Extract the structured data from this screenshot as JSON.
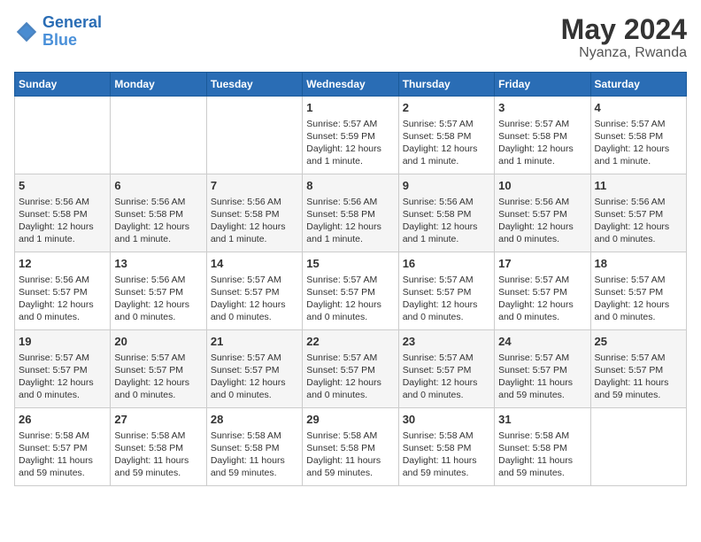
{
  "logo": {
    "line1": "General",
    "line2": "Blue"
  },
  "title": {
    "month_year": "May 2024",
    "location": "Nyanza, Rwanda"
  },
  "header_days": [
    "Sunday",
    "Monday",
    "Tuesday",
    "Wednesday",
    "Thursday",
    "Friday",
    "Saturday"
  ],
  "weeks": [
    {
      "days": [
        {
          "num": "",
          "info": ""
        },
        {
          "num": "",
          "info": ""
        },
        {
          "num": "",
          "info": ""
        },
        {
          "num": "1",
          "info": "Sunrise: 5:57 AM\nSunset: 5:59 PM\nDaylight: 12 hours\nand 1 minute."
        },
        {
          "num": "2",
          "info": "Sunrise: 5:57 AM\nSunset: 5:58 PM\nDaylight: 12 hours\nand 1 minute."
        },
        {
          "num": "3",
          "info": "Sunrise: 5:57 AM\nSunset: 5:58 PM\nDaylight: 12 hours\nand 1 minute."
        },
        {
          "num": "4",
          "info": "Sunrise: 5:57 AM\nSunset: 5:58 PM\nDaylight: 12 hours\nand 1 minute."
        }
      ]
    },
    {
      "days": [
        {
          "num": "5",
          "info": "Sunrise: 5:56 AM\nSunset: 5:58 PM\nDaylight: 12 hours\nand 1 minute."
        },
        {
          "num": "6",
          "info": "Sunrise: 5:56 AM\nSunset: 5:58 PM\nDaylight: 12 hours\nand 1 minute."
        },
        {
          "num": "7",
          "info": "Sunrise: 5:56 AM\nSunset: 5:58 PM\nDaylight: 12 hours\nand 1 minute."
        },
        {
          "num": "8",
          "info": "Sunrise: 5:56 AM\nSunset: 5:58 PM\nDaylight: 12 hours\nand 1 minute."
        },
        {
          "num": "9",
          "info": "Sunrise: 5:56 AM\nSunset: 5:58 PM\nDaylight: 12 hours\nand 1 minute."
        },
        {
          "num": "10",
          "info": "Sunrise: 5:56 AM\nSunset: 5:57 PM\nDaylight: 12 hours\nand 0 minutes."
        },
        {
          "num": "11",
          "info": "Sunrise: 5:56 AM\nSunset: 5:57 PM\nDaylight: 12 hours\nand 0 minutes."
        }
      ]
    },
    {
      "days": [
        {
          "num": "12",
          "info": "Sunrise: 5:56 AM\nSunset: 5:57 PM\nDaylight: 12 hours\nand 0 minutes."
        },
        {
          "num": "13",
          "info": "Sunrise: 5:56 AM\nSunset: 5:57 PM\nDaylight: 12 hours\nand 0 minutes."
        },
        {
          "num": "14",
          "info": "Sunrise: 5:57 AM\nSunset: 5:57 PM\nDaylight: 12 hours\nand 0 minutes."
        },
        {
          "num": "15",
          "info": "Sunrise: 5:57 AM\nSunset: 5:57 PM\nDaylight: 12 hours\nand 0 minutes."
        },
        {
          "num": "16",
          "info": "Sunrise: 5:57 AM\nSunset: 5:57 PM\nDaylight: 12 hours\nand 0 minutes."
        },
        {
          "num": "17",
          "info": "Sunrise: 5:57 AM\nSunset: 5:57 PM\nDaylight: 12 hours\nand 0 minutes."
        },
        {
          "num": "18",
          "info": "Sunrise: 5:57 AM\nSunset: 5:57 PM\nDaylight: 12 hours\nand 0 minutes."
        }
      ]
    },
    {
      "days": [
        {
          "num": "19",
          "info": "Sunrise: 5:57 AM\nSunset: 5:57 PM\nDaylight: 12 hours\nand 0 minutes."
        },
        {
          "num": "20",
          "info": "Sunrise: 5:57 AM\nSunset: 5:57 PM\nDaylight: 12 hours\nand 0 minutes."
        },
        {
          "num": "21",
          "info": "Sunrise: 5:57 AM\nSunset: 5:57 PM\nDaylight: 12 hours\nand 0 minutes."
        },
        {
          "num": "22",
          "info": "Sunrise: 5:57 AM\nSunset: 5:57 PM\nDaylight: 12 hours\nand 0 minutes."
        },
        {
          "num": "23",
          "info": "Sunrise: 5:57 AM\nSunset: 5:57 PM\nDaylight: 12 hours\nand 0 minutes."
        },
        {
          "num": "24",
          "info": "Sunrise: 5:57 AM\nSunset: 5:57 PM\nDaylight: 11 hours\nand 59 minutes."
        },
        {
          "num": "25",
          "info": "Sunrise: 5:57 AM\nSunset: 5:57 PM\nDaylight: 11 hours\nand 59 minutes."
        }
      ]
    },
    {
      "days": [
        {
          "num": "26",
          "info": "Sunrise: 5:58 AM\nSunset: 5:57 PM\nDaylight: 11 hours\nand 59 minutes."
        },
        {
          "num": "27",
          "info": "Sunrise: 5:58 AM\nSunset: 5:58 PM\nDaylight: 11 hours\nand 59 minutes."
        },
        {
          "num": "28",
          "info": "Sunrise: 5:58 AM\nSunset: 5:58 PM\nDaylight: 11 hours\nand 59 minutes."
        },
        {
          "num": "29",
          "info": "Sunrise: 5:58 AM\nSunset: 5:58 PM\nDaylight: 11 hours\nand 59 minutes."
        },
        {
          "num": "30",
          "info": "Sunrise: 5:58 AM\nSunset: 5:58 PM\nDaylight: 11 hours\nand 59 minutes."
        },
        {
          "num": "31",
          "info": "Sunrise: 5:58 AM\nSunset: 5:58 PM\nDaylight: 11 hours\nand 59 minutes."
        },
        {
          "num": "",
          "info": ""
        }
      ]
    }
  ]
}
